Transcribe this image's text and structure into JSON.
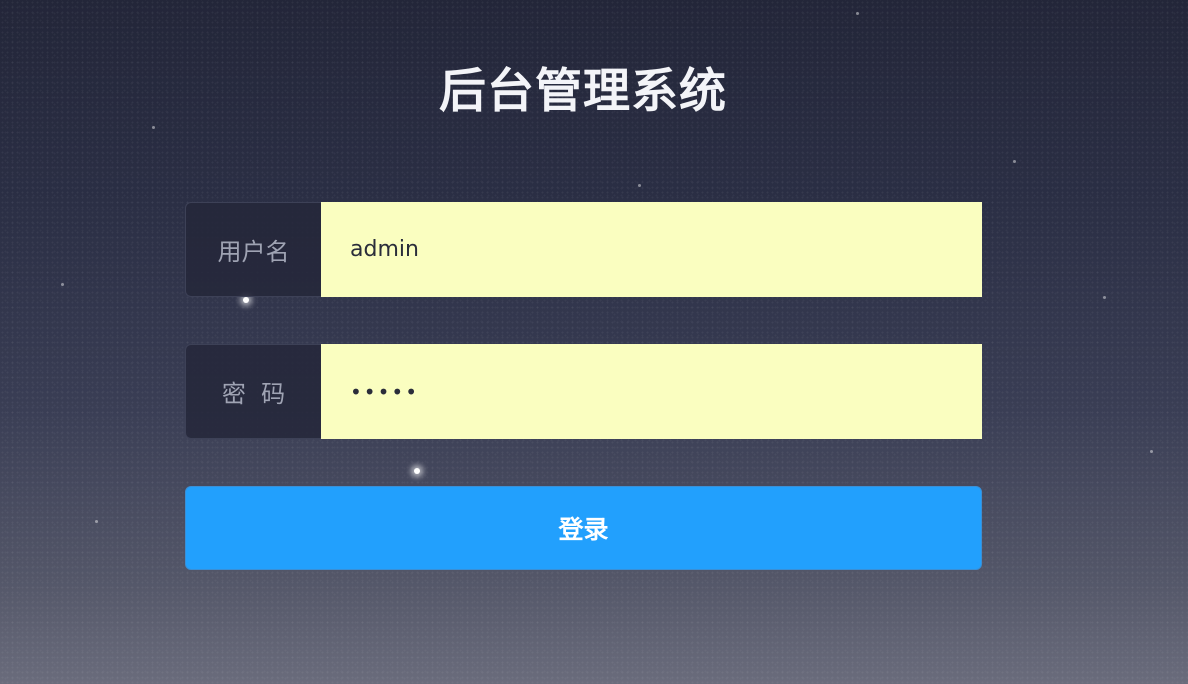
{
  "app": {
    "title": "后台管理系统"
  },
  "form": {
    "username": {
      "label": "用户名",
      "value": "admin"
    },
    "password": {
      "label": "密  码",
      "value": "admin"
    },
    "submit_label": "登录"
  },
  "colors": {
    "background_top": "#232639",
    "background_bottom": "#6a6c7c",
    "input_fill": "#fafec0",
    "button": "#22a0fd",
    "button_text": "#ffffff"
  }
}
